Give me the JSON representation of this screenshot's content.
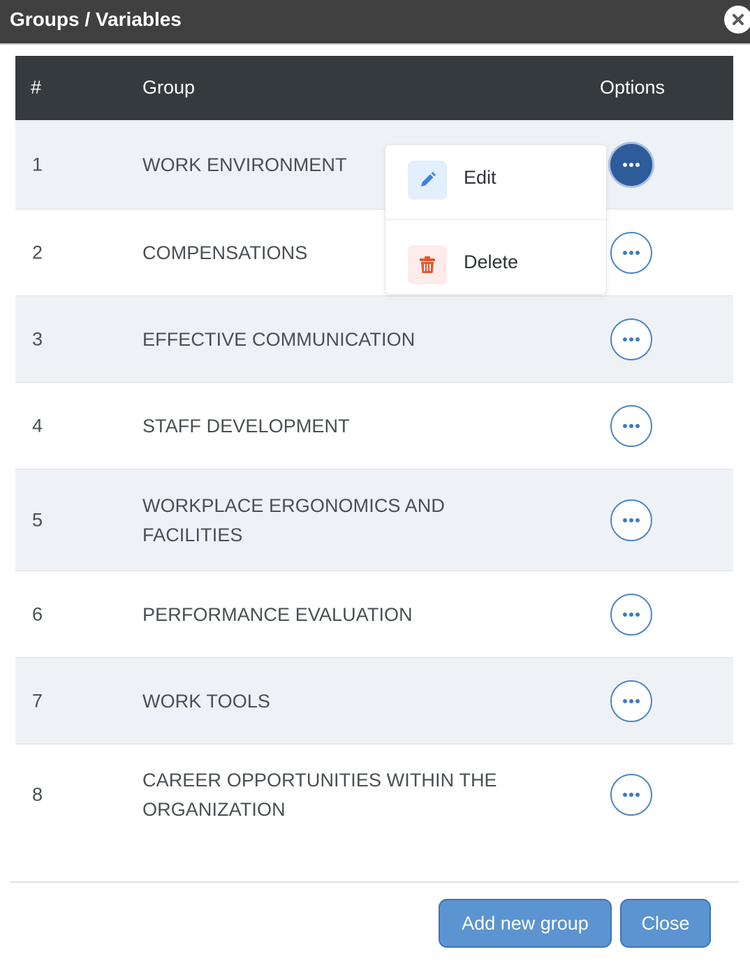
{
  "window": {
    "title": "Groups / Variables",
    "close_icon": "close-icon"
  },
  "table": {
    "headers": {
      "num": "#",
      "group": "Group",
      "options": "Options"
    },
    "rows": [
      {
        "num": "1",
        "name": "WORK ENVIRONMENT"
      },
      {
        "num": "2",
        "name": "COMPENSATIONS"
      },
      {
        "num": "3",
        "name": "EFFECTIVE COMMUNICATION"
      },
      {
        "num": "4",
        "name": "STAFF DEVELOPMENT"
      },
      {
        "num": "5",
        "name": "WORKPLACE ERGONOMICS AND FACILITIES"
      },
      {
        "num": "6",
        "name": "PERFORMANCE EVALUATION"
      },
      {
        "num": "7",
        "name": "WORK TOOLS"
      },
      {
        "num": "8",
        "name": "CAREER OPPORTUNITIES WITHIN THE ORGANIZATION"
      }
    ]
  },
  "dropdown": {
    "items": [
      {
        "label": "Edit",
        "icon": "pencil-icon"
      },
      {
        "label": "Delete",
        "icon": "trash-icon"
      }
    ]
  },
  "footer": {
    "add_label": "Add new group",
    "close_label": "Close"
  },
  "colors": {
    "titlebar": "#404040",
    "table_header": "#353a3e",
    "row_striped": "#eef2f6",
    "accent": "#2e5b9a",
    "button": "#5b94d0"
  }
}
